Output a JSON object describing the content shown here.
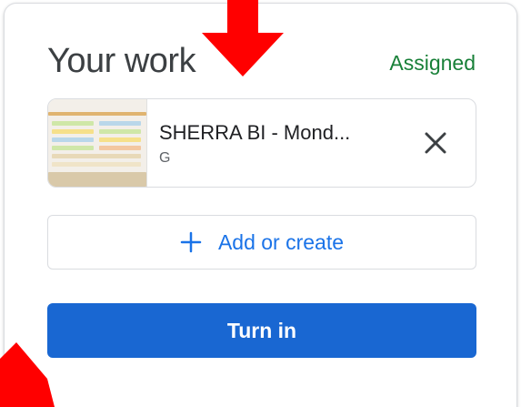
{
  "card": {
    "title": "Your work",
    "status": "Assigned"
  },
  "attachment": {
    "title": "SHERRA BI - Mond...",
    "subtitle": "G",
    "remove_icon": "close-icon",
    "thumbnail": "spreadsheet-thumbnail"
  },
  "actions": {
    "add_label": "Add or create",
    "add_icon": "plus-icon",
    "turn_in_label": "Turn in"
  },
  "annotations": {
    "arrow_color": "#ff0000"
  },
  "colors": {
    "status_green": "#188038",
    "accent_blue": "#1a73e8",
    "button_blue": "#1967d2"
  }
}
